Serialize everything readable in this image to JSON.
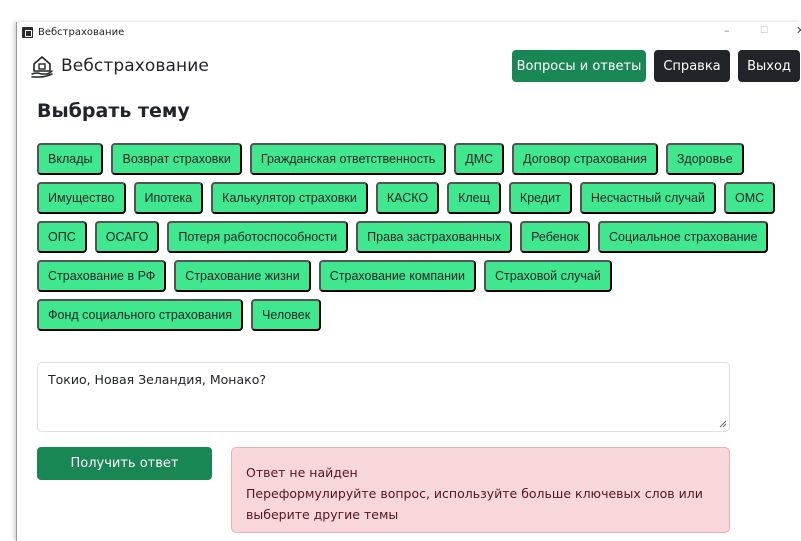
{
  "window": {
    "title": "Вебстрахование",
    "minimize_glyph": "–",
    "maximize_glyph": "☐",
    "close_glyph": "✕"
  },
  "header": {
    "brand_name": "Вебстрахование",
    "brand_icon": "house-hand-icon",
    "buttons": {
      "faq": "Вопросы и ответы",
      "help": "Справка",
      "exit": "Выход"
    }
  },
  "section_title": "Выбрать тему",
  "topics": [
    [
      "Вклады",
      "Возврат страховки",
      "Гражданская ответственность",
      "ДМС",
      "Договор страхования",
      "Здоровье"
    ],
    [
      "Имущество",
      "Ипотека",
      "Калькулятор страховки",
      "КАСКО",
      "Клещ",
      "Кредит",
      "Несчастный случай",
      "ОМС"
    ],
    [
      "ОПС",
      "ОСАГО",
      "Потеря работоспособности",
      "Права застрахованных",
      "Ребенок",
      "Социальное страхование"
    ],
    [
      "Страхование в РФ",
      "Страхование жизни",
      "Страхование компании",
      "Страховой случай"
    ],
    [
      "Фонд социального страхования",
      "Человек"
    ]
  ],
  "question": {
    "value": "Токио, Новая Зеландия, Монако?"
  },
  "answer_button": "Получить ответ",
  "alert": {
    "title": "Ответ не найден",
    "line1": "Переформулируйте вопрос, используйте больше ключевых слов или",
    "line2": "выберите другие темы"
  },
  "colors": {
    "primary_green": "#198754",
    "topic_green": "#3fe88f",
    "dark": "#212529",
    "alert_bg": "#f8d7da",
    "alert_text": "#58151c"
  }
}
